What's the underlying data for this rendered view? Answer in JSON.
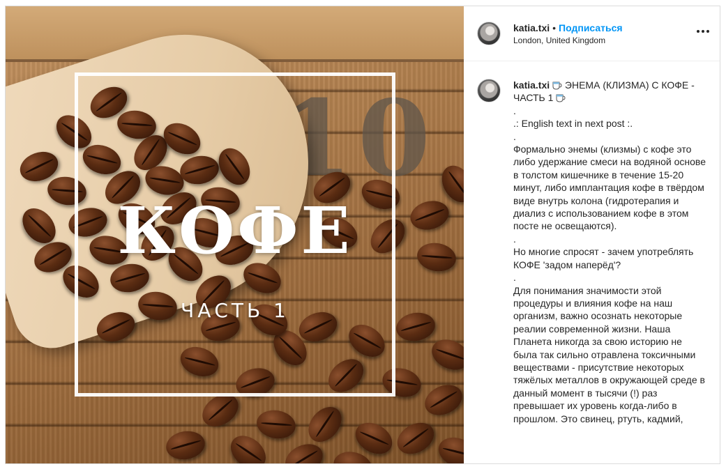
{
  "media": {
    "overlay_title": "КОФЕ",
    "overlay_subtitle": "ЧАСТЬ 1",
    "background_number": "710"
  },
  "header": {
    "username": "katia.txi",
    "separator": "•",
    "follow_label": "Подписаться",
    "location": "London, United Kingdom",
    "more_icon": "more-options-icon"
  },
  "caption": {
    "username": "katia.txi",
    "emoji_icon": "coffee-cup-icon",
    "title": "ЭНЕМА (КЛИЗМА) С КОФЕ - ЧАСТЬ 1",
    "body": ".\n.: English text in next post :.\n.\nФормально энемы (клизмы) с кофе это либо удержание смеси на водяной основе в толстом кишечнике в течение 15-20 минут, либо имплантация кофе в твёрдом виде внутрь колона (гидротерапия и диализ с использованием кофе в этом посте не освещаются).\n.\nНо многие спросят - зачем употреблять КОФЕ 'задом наперёд'?\n.\nДля понимания значимости этой процедуры и влияния кофе на наш организм, важно осознать некоторые реалии современной жизни. Наша Планета никогда за свою историю не была так сильно отравлена токсичными веществами - присутствие некоторых тяжёлых металлов в окружающей среде в данный момент в тысячи (!) раз превышает их уровень когда-либо в прошлом. Это свинец, ртуть, кадмий,"
  },
  "colors": {
    "accent": "#0095f6",
    "text": "#262626",
    "border": "#dbdbdb"
  }
}
